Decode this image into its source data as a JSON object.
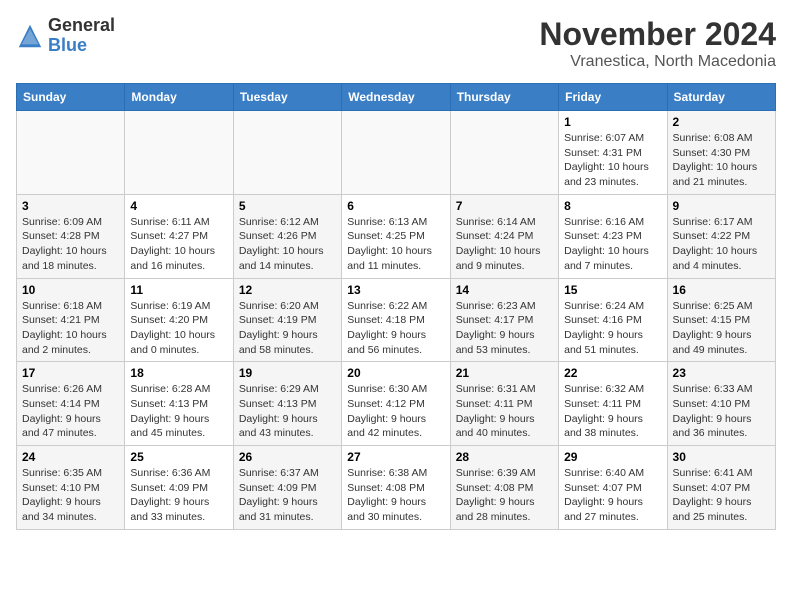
{
  "header": {
    "logo_general": "General",
    "logo_blue": "Blue",
    "month_title": "November 2024",
    "location": "Vranestica, North Macedonia"
  },
  "days_of_week": [
    "Sunday",
    "Monday",
    "Tuesday",
    "Wednesday",
    "Thursday",
    "Friday",
    "Saturday"
  ],
  "weeks": [
    [
      {
        "day": "",
        "info": ""
      },
      {
        "day": "",
        "info": ""
      },
      {
        "day": "",
        "info": ""
      },
      {
        "day": "",
        "info": ""
      },
      {
        "day": "",
        "info": ""
      },
      {
        "day": "1",
        "info": "Sunrise: 6:07 AM\nSunset: 4:31 PM\nDaylight: 10 hours\nand 23 minutes."
      },
      {
        "day": "2",
        "info": "Sunrise: 6:08 AM\nSunset: 4:30 PM\nDaylight: 10 hours\nand 21 minutes."
      }
    ],
    [
      {
        "day": "3",
        "info": "Sunrise: 6:09 AM\nSunset: 4:28 PM\nDaylight: 10 hours\nand 18 minutes."
      },
      {
        "day": "4",
        "info": "Sunrise: 6:11 AM\nSunset: 4:27 PM\nDaylight: 10 hours\nand 16 minutes."
      },
      {
        "day": "5",
        "info": "Sunrise: 6:12 AM\nSunset: 4:26 PM\nDaylight: 10 hours\nand 14 minutes."
      },
      {
        "day": "6",
        "info": "Sunrise: 6:13 AM\nSunset: 4:25 PM\nDaylight: 10 hours\nand 11 minutes."
      },
      {
        "day": "7",
        "info": "Sunrise: 6:14 AM\nSunset: 4:24 PM\nDaylight: 10 hours\nand 9 minutes."
      },
      {
        "day": "8",
        "info": "Sunrise: 6:16 AM\nSunset: 4:23 PM\nDaylight: 10 hours\nand 7 minutes."
      },
      {
        "day": "9",
        "info": "Sunrise: 6:17 AM\nSunset: 4:22 PM\nDaylight: 10 hours\nand 4 minutes."
      }
    ],
    [
      {
        "day": "10",
        "info": "Sunrise: 6:18 AM\nSunset: 4:21 PM\nDaylight: 10 hours\nand 2 minutes."
      },
      {
        "day": "11",
        "info": "Sunrise: 6:19 AM\nSunset: 4:20 PM\nDaylight: 10 hours\nand 0 minutes."
      },
      {
        "day": "12",
        "info": "Sunrise: 6:20 AM\nSunset: 4:19 PM\nDaylight: 9 hours\nand 58 minutes."
      },
      {
        "day": "13",
        "info": "Sunrise: 6:22 AM\nSunset: 4:18 PM\nDaylight: 9 hours\nand 56 minutes."
      },
      {
        "day": "14",
        "info": "Sunrise: 6:23 AM\nSunset: 4:17 PM\nDaylight: 9 hours\nand 53 minutes."
      },
      {
        "day": "15",
        "info": "Sunrise: 6:24 AM\nSunset: 4:16 PM\nDaylight: 9 hours\nand 51 minutes."
      },
      {
        "day": "16",
        "info": "Sunrise: 6:25 AM\nSunset: 4:15 PM\nDaylight: 9 hours\nand 49 minutes."
      }
    ],
    [
      {
        "day": "17",
        "info": "Sunrise: 6:26 AM\nSunset: 4:14 PM\nDaylight: 9 hours\nand 47 minutes."
      },
      {
        "day": "18",
        "info": "Sunrise: 6:28 AM\nSunset: 4:13 PM\nDaylight: 9 hours\nand 45 minutes."
      },
      {
        "day": "19",
        "info": "Sunrise: 6:29 AM\nSunset: 4:13 PM\nDaylight: 9 hours\nand 43 minutes."
      },
      {
        "day": "20",
        "info": "Sunrise: 6:30 AM\nSunset: 4:12 PM\nDaylight: 9 hours\nand 42 minutes."
      },
      {
        "day": "21",
        "info": "Sunrise: 6:31 AM\nSunset: 4:11 PM\nDaylight: 9 hours\nand 40 minutes."
      },
      {
        "day": "22",
        "info": "Sunrise: 6:32 AM\nSunset: 4:11 PM\nDaylight: 9 hours\nand 38 minutes."
      },
      {
        "day": "23",
        "info": "Sunrise: 6:33 AM\nSunset: 4:10 PM\nDaylight: 9 hours\nand 36 minutes."
      }
    ],
    [
      {
        "day": "24",
        "info": "Sunrise: 6:35 AM\nSunset: 4:10 PM\nDaylight: 9 hours\nand 34 minutes."
      },
      {
        "day": "25",
        "info": "Sunrise: 6:36 AM\nSunset: 4:09 PM\nDaylight: 9 hours\nand 33 minutes."
      },
      {
        "day": "26",
        "info": "Sunrise: 6:37 AM\nSunset: 4:09 PM\nDaylight: 9 hours\nand 31 minutes."
      },
      {
        "day": "27",
        "info": "Sunrise: 6:38 AM\nSunset: 4:08 PM\nDaylight: 9 hours\nand 30 minutes."
      },
      {
        "day": "28",
        "info": "Sunrise: 6:39 AM\nSunset: 4:08 PM\nDaylight: 9 hours\nand 28 minutes."
      },
      {
        "day": "29",
        "info": "Sunrise: 6:40 AM\nSunset: 4:07 PM\nDaylight: 9 hours\nand 27 minutes."
      },
      {
        "day": "30",
        "info": "Sunrise: 6:41 AM\nSunset: 4:07 PM\nDaylight: 9 hours\nand 25 minutes."
      }
    ]
  ]
}
